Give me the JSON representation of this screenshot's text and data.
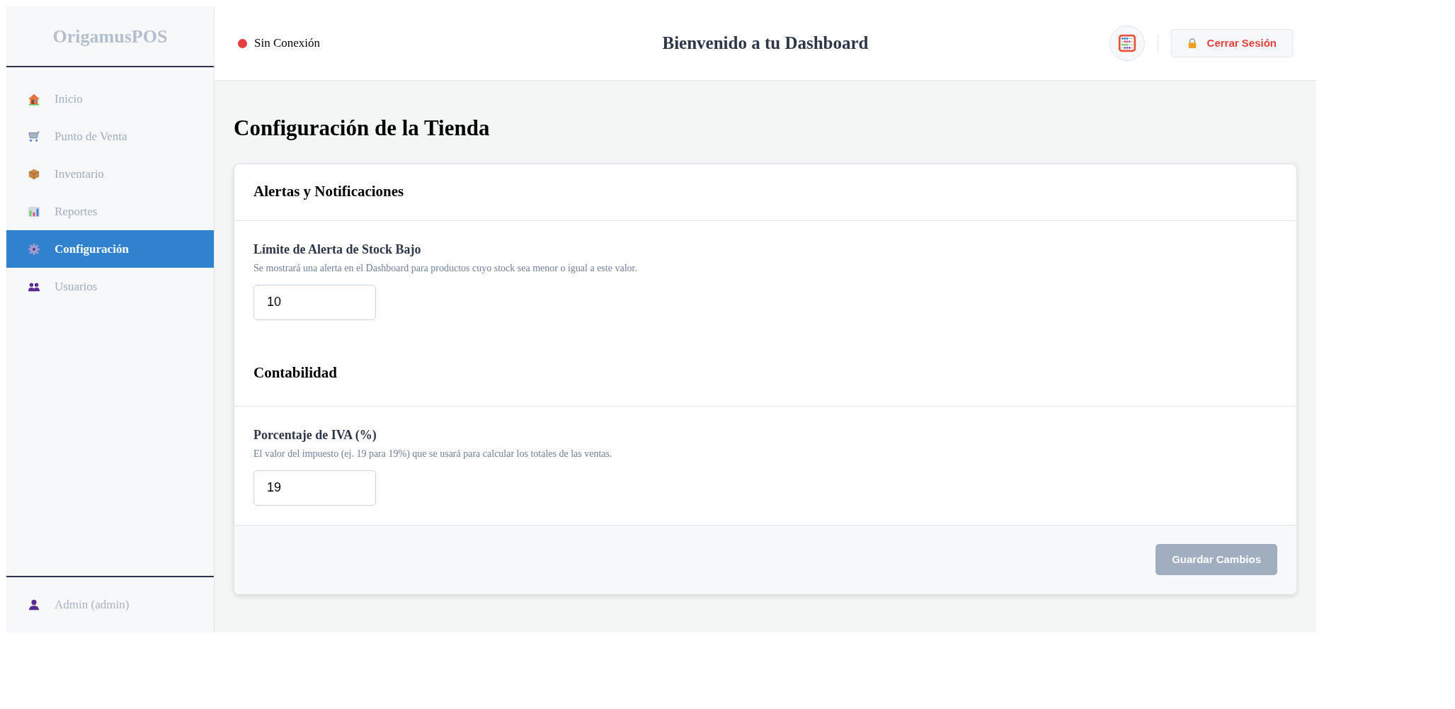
{
  "sidebar": {
    "logo": "OrigamusPOS",
    "items": [
      {
        "label": "Inicio",
        "selected": false
      },
      {
        "label": "Punto de Venta",
        "selected": false
      },
      {
        "label": "Inventario",
        "selected": false
      },
      {
        "label": "Reportes",
        "selected": false
      },
      {
        "label": "Configuración",
        "selected": true
      },
      {
        "label": "Usuarios",
        "selected": false
      }
    ],
    "user": "Admin (admin)"
  },
  "header": {
    "status": {
      "label": "Sin Conexión",
      "online": false
    },
    "title": "Bienvenido a tu Dashboard",
    "logout": "Cerrar Sesión"
  },
  "page": {
    "title": "Configuración de la Tienda",
    "sections": [
      {
        "title": "Alertas y Notificaciones",
        "fields": [
          {
            "label": "Límite de Alerta de Stock Bajo",
            "help": "Se mostrará una alerta en el Dashboard para productos cuyo stock sea menor o igual a este valor.",
            "value": "10"
          }
        ]
      },
      {
        "title": "Contabilidad",
        "fields": [
          {
            "label": "Porcentaje de IVA (%)",
            "help": "El valor del impuesto (ej. 19 para 19%) que se usará para calcular los totales de las ventas.",
            "value": "19"
          }
        ]
      }
    ],
    "save": {
      "label": "Guardar Cambios",
      "disabled": true
    }
  }
}
